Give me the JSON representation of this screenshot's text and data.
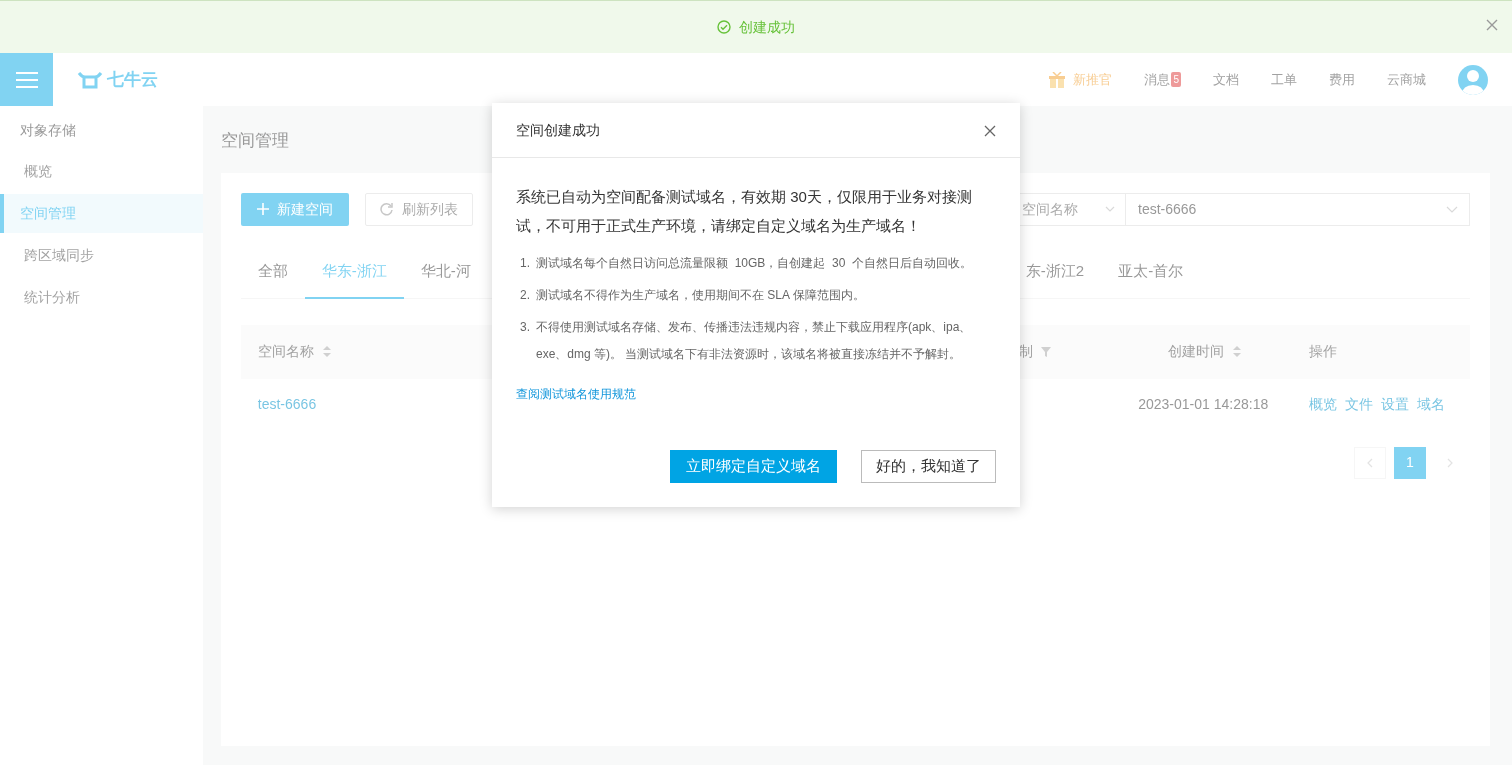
{
  "toast": {
    "message": "创建成功"
  },
  "header": {
    "logo": "七牛云",
    "nav": [
      {
        "kind": "gift",
        "label": "新推官"
      },
      {
        "kind": "badge",
        "label": "消息",
        "badge": "5"
      },
      {
        "kind": "text",
        "label": "文档"
      },
      {
        "kind": "text",
        "label": "工单"
      },
      {
        "kind": "text",
        "label": "费用"
      },
      {
        "kind": "text",
        "label": "云商城"
      }
    ]
  },
  "sidebar": {
    "title": "对象存储",
    "items": [
      {
        "label": "概览",
        "selected": false
      },
      {
        "label": "空间管理",
        "selected": true
      },
      {
        "label": "跨区域同步",
        "selected": false
      },
      {
        "label": "统计分析",
        "selected": false
      }
    ]
  },
  "page": {
    "title": "空间管理",
    "toolbar": {
      "buttons": [
        {
          "kind": "primary",
          "label": "新建空间"
        },
        {
          "kind": "refresh",
          "label": "刷新列表"
        }
      ],
      "filter": "空间名称",
      "search": "test-6666"
    },
    "tabs": [
      {
        "label": "全部",
        "selected": false
      },
      {
        "label": "华东-浙江",
        "selected": true
      },
      {
        "label": "华北-河",
        "selected": false
      },
      {
        "label": "东-浙江2",
        "selected": false
      },
      {
        "label": "亚太-首尔",
        "selected": false
      }
    ],
    "table": {
      "columns": [
        {
          "label": "空间名称",
          "sortable": true
        },
        {
          "label": "制",
          "filterable": true
        },
        {
          "label": "创建时间",
          "sortable": true
        },
        {
          "label": "操作"
        }
      ],
      "rows": [
        {
          "name": "test-6666",
          "created": "2023-01-01 14:28:18",
          "actions": [
            "概览",
            "文件",
            "设置",
            "域名"
          ]
        }
      ]
    },
    "pagination": {
      "pages": [
        {
          "label": "1",
          "selected": true
        }
      ]
    }
  },
  "modal": {
    "title": "空间创建成功",
    "lead": "系统已自动为空间配备测试域名，有效期 30天，仅限用于业务对接测试，不可用于正式生产环境，请绑定自定义域名为生产域名！",
    "notes": [
      {
        "number": "1.",
        "text": "测试域名每个自然日访问总流量限额  10GB，自创建起  30  个自然日后自动回收。"
      },
      {
        "number": "2.",
        "text": "测试域名不得作为生产域名，使用期间不在 SLA 保障范围内。"
      },
      {
        "number": "3.",
        "text": "不得使用测试域名存储、发布、传播违法违规内容，禁止下载应用程序(apk、ipa、exe、dmg 等)。 当测试域名下有非法资源时，该域名将被直接冻结并不予解封。"
      }
    ],
    "link": "查阅测试域名使用规范",
    "buttons": [
      {
        "kind": "primary",
        "label": "立即绑定自定义域名"
      },
      {
        "kind": "secondary",
        "label": "好的，我知道了"
      }
    ]
  }
}
